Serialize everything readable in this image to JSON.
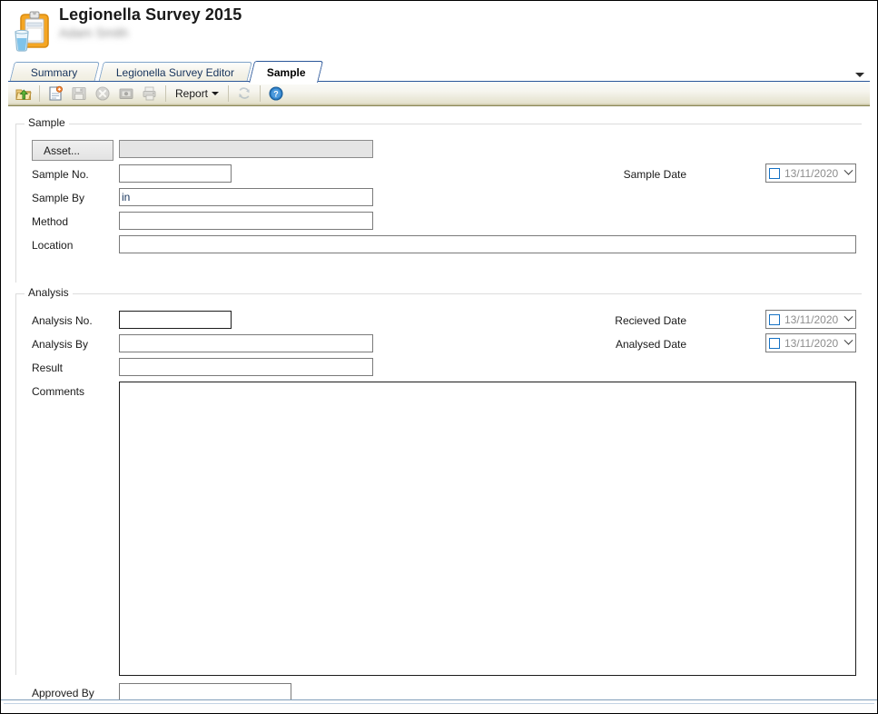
{
  "window": {
    "title": "Legionella Survey 2015",
    "subtitle": "Adam Smith",
    "app_icon": "clipboard-sample-icon",
    "accent_color": "#2a5699"
  },
  "tabs": {
    "items": [
      {
        "label": "Summary",
        "active": false
      },
      {
        "label": "Legionella Survey Editor",
        "active": false
      },
      {
        "label": "Sample",
        "active": true
      }
    ],
    "overflow_icon": "chevron-down-icon"
  },
  "toolbar": {
    "buttons": [
      {
        "name": "open-folder-up-button",
        "icon": "folder-up-arrow-icon",
        "enabled": true
      },
      {
        "name": "new-record-button",
        "icon": "new-document-icon",
        "enabled": true
      },
      {
        "name": "save-button",
        "icon": "floppy-disk-icon",
        "enabled": false
      },
      {
        "name": "delete-button",
        "icon": "cancel-circle-icon",
        "enabled": false
      },
      {
        "name": "camera-button",
        "icon": "camera-icon",
        "enabled": false
      },
      {
        "name": "print-button",
        "icon": "printer-icon",
        "enabled": false
      }
    ],
    "report_label": "Report",
    "refresh_icon": "refresh-icon",
    "help_icon": "help-question-icon"
  },
  "sample": {
    "group_label": "Sample",
    "asset_button_label": "Asset...",
    "asset_value": "",
    "fields": {
      "sample_no_label": "Sample No.",
      "sample_no_value": "",
      "sample_by_label": "Sample By",
      "sample_by_value": "in",
      "method_label": "Method",
      "method_value": "",
      "location_label": "Location",
      "location_value": ""
    },
    "sample_date_label": "Sample Date",
    "sample_date_value": "13/11/2020",
    "sample_date_checked": false
  },
  "analysis": {
    "group_label": "Analysis",
    "fields": {
      "analysis_no_label": "Analysis No.",
      "analysis_no_value": "",
      "analysis_by_label": "Analysis By",
      "analysis_by_value": "",
      "result_label": "Result",
      "result_value": "",
      "comments_label": "Comments",
      "comments_value": "",
      "approved_by_label": "Approved By",
      "approved_by_value": ""
    },
    "recieved_date_label": "Recieved Date",
    "recieved_date_value": "13/11/2020",
    "recieved_date_checked": false,
    "analysed_date_label": "Analysed Date",
    "analysed_date_value": "13/11/2020",
    "analysed_date_checked": false
  }
}
